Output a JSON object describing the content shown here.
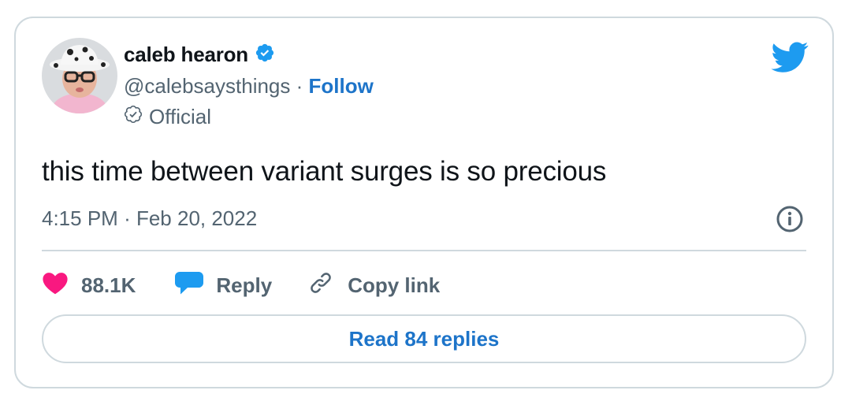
{
  "author": {
    "name": "caleb hearon",
    "handle": "@calebsaysthings",
    "separator": "·",
    "follow_label": "Follow",
    "badge_label": "Official"
  },
  "tweet": {
    "text": "this time between variant surges is so precious",
    "time": "4:15 PM",
    "date": "Feb 20, 2022"
  },
  "actions": {
    "likes": "88.1K",
    "reply_label": "Reply",
    "copy_link_label": "Copy link"
  },
  "read_replies_label": "Read 84 replies",
  "colors": {
    "accent": "#1d74c9",
    "verified": "#1d9bf0",
    "heart": "#f91880",
    "text_secondary": "#536471",
    "border": "#cfd9de"
  },
  "icons": [
    "verified-badge-icon",
    "twitter-bird-icon",
    "official-check-icon",
    "info-icon",
    "heart-icon",
    "reply-bubble-icon",
    "link-icon"
  ]
}
